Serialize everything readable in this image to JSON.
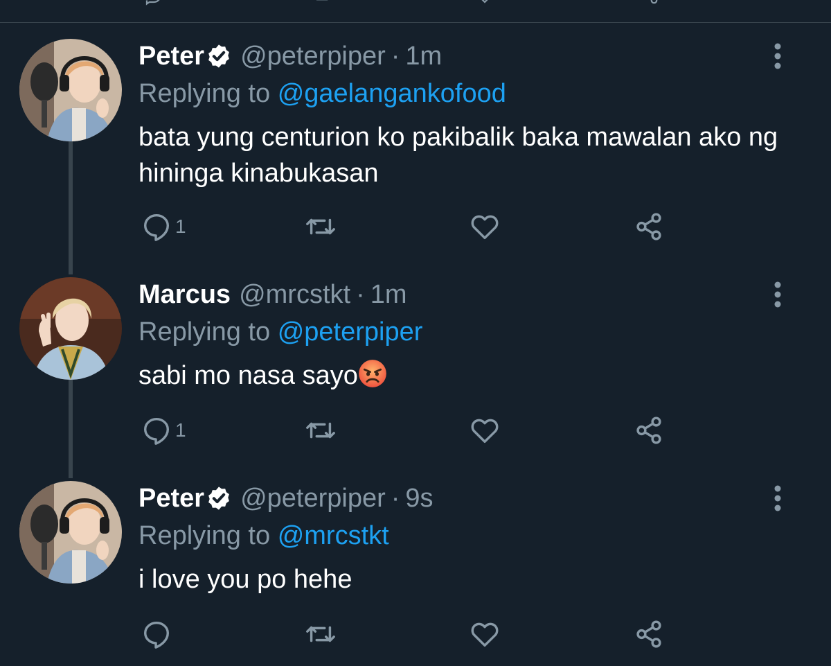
{
  "colors": {
    "background": "#15202b",
    "text": "#ffffff",
    "secondary": "#8899a6",
    "accent": "#1da1f2",
    "divider": "#38444d"
  },
  "tweets": [
    {
      "name": "Peter",
      "verified": true,
      "handle": "@peterpiper",
      "separator": "·",
      "time": "1m",
      "replying_label": "Replying to",
      "replying_to": "@gaelangankofood",
      "text": "bata yung centurion ko pakibalik baka mawalan ako ng hininga kinabukasan",
      "reply_count": "1",
      "avatar_icon": "avatar-peter"
    },
    {
      "name": "Marcus",
      "verified": false,
      "handle": "@mrcstkt",
      "separator": "·",
      "time": "1m",
      "replying_label": "Replying to",
      "replying_to": "@peterpiper",
      "text": "sabi mo nasa sayo",
      "emoji": "angry-face",
      "reply_count": "1",
      "avatar_icon": "avatar-marcus"
    },
    {
      "name": "Peter",
      "verified": true,
      "handle": "@peterpiper",
      "separator": "·",
      "time": "9s",
      "replying_label": "Replying to",
      "replying_to": "@mrcstkt",
      "text": "i love you po hehe",
      "reply_count": "",
      "avatar_icon": "avatar-peter"
    }
  ]
}
